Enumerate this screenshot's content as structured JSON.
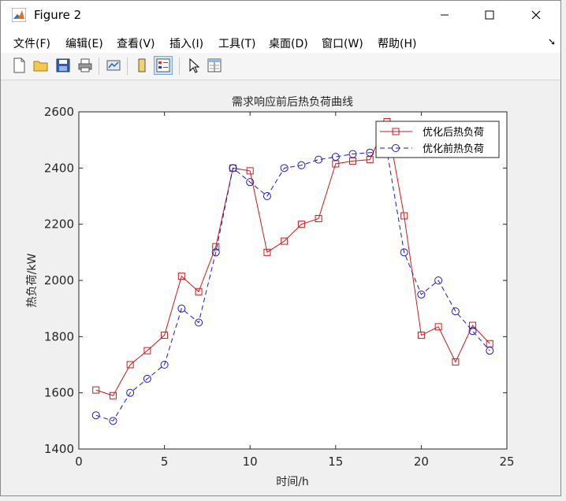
{
  "window": {
    "title": "Figure 2"
  },
  "menu": [
    "文件(F)",
    "编辑(E)",
    "查看(V)",
    "插入(I)",
    "工具(T)",
    "桌面(D)",
    "窗口(W)",
    "帮助(H)"
  ],
  "toolbar": [
    "new-figure-icon",
    "open-file-icon",
    "save-icon",
    "print-icon",
    "link-plot-icon",
    "colorbar-icon",
    "legend-icon",
    "pointer-icon",
    "property-inspector-icon"
  ],
  "chart_data": {
    "type": "line",
    "title": "需求响应前后热负荷曲线",
    "xlabel": "时间/h",
    "ylabel": "热负荷/kW",
    "xlim": [
      0,
      25
    ],
    "ylim": [
      1400,
      2600
    ],
    "xticks": [
      0,
      5,
      10,
      15,
      20,
      25
    ],
    "yticks": [
      1400,
      1600,
      1800,
      2000,
      2200,
      2400,
      2600
    ],
    "grid": false,
    "legend_position": "top-right",
    "x": [
      1,
      2,
      3,
      4,
      5,
      6,
      7,
      8,
      9,
      10,
      11,
      12,
      13,
      14,
      15,
      16,
      17,
      18,
      19,
      20,
      21,
      22,
      23,
      24
    ],
    "series": [
      {
        "name": "优化后热负荷",
        "color": "#cc1a1a",
        "marker": "square",
        "line": "solid",
        "values": [
          1610,
          1590,
          1700,
          1750,
          1805,
          2015,
          1960,
          2120,
          2400,
          2390,
          2100,
          2140,
          2200,
          2220,
          2415,
          2425,
          2430,
          2565,
          2230,
          1805,
          1835,
          1710,
          1840,
          1775
        ]
      },
      {
        "name": "优化前热负荷",
        "color": "#1a1acc",
        "marker": "circle",
        "line": "dashed",
        "values": [
          1520,
          1500,
          1600,
          1650,
          1700,
          1900,
          1850,
          2100,
          2400,
          2350,
          2300,
          2400,
          2410,
          2430,
          2440,
          2450,
          2455,
          2460,
          2100,
          1950,
          2000,
          1890,
          1820,
          1750
        ]
      }
    ]
  }
}
